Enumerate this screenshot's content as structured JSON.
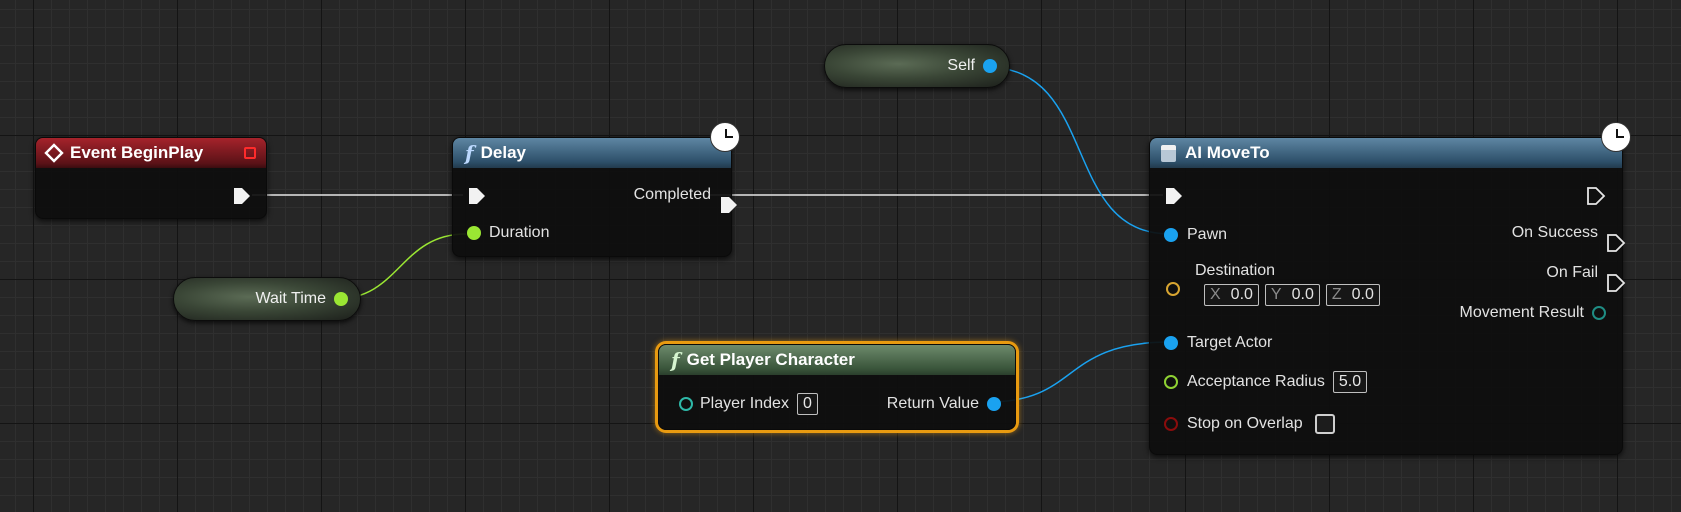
{
  "nodes": {
    "begin_play": {
      "title": "Event BeginPlay"
    },
    "delay": {
      "title": "Delay",
      "func_glyph": "f",
      "completed_label": "Completed",
      "duration_label": "Duration"
    },
    "wait_time": {
      "label": "Wait Time"
    },
    "self": {
      "label": "Self"
    },
    "get_player": {
      "title": "Get Player Character",
      "func_glyph": "f",
      "player_index_label": "Player Index",
      "player_index_value": "0",
      "return_label": "Return Value"
    },
    "ai_moveto": {
      "title": "AI MoveTo",
      "pawn_label": "Pawn",
      "destination_label": "Destination",
      "dest_x_axis": "X",
      "dest_x": "0.0",
      "dest_y_axis": "Y",
      "dest_y": "0.0",
      "dest_z_axis": "Z",
      "dest_z": "0.0",
      "target_actor_label": "Target Actor",
      "acceptance_radius_label": "Acceptance Radius",
      "acceptance_radius_value": "5.0",
      "stop_on_overlap_label": "Stop on Overlap",
      "stop_on_overlap_checked": false,
      "on_success_label": "On Success",
      "on_fail_label": "On Fail",
      "movement_result_label": "Movement Result"
    }
  },
  "colors": {
    "exec_wire": "#e6e6e6",
    "object_wire": "#1aa2f0",
    "float_wire": "#9ae633",
    "event_header": "#a5232b",
    "function_header": "#2d4f69",
    "pure_function_header": "#39543a",
    "selection": "#e89a10"
  }
}
